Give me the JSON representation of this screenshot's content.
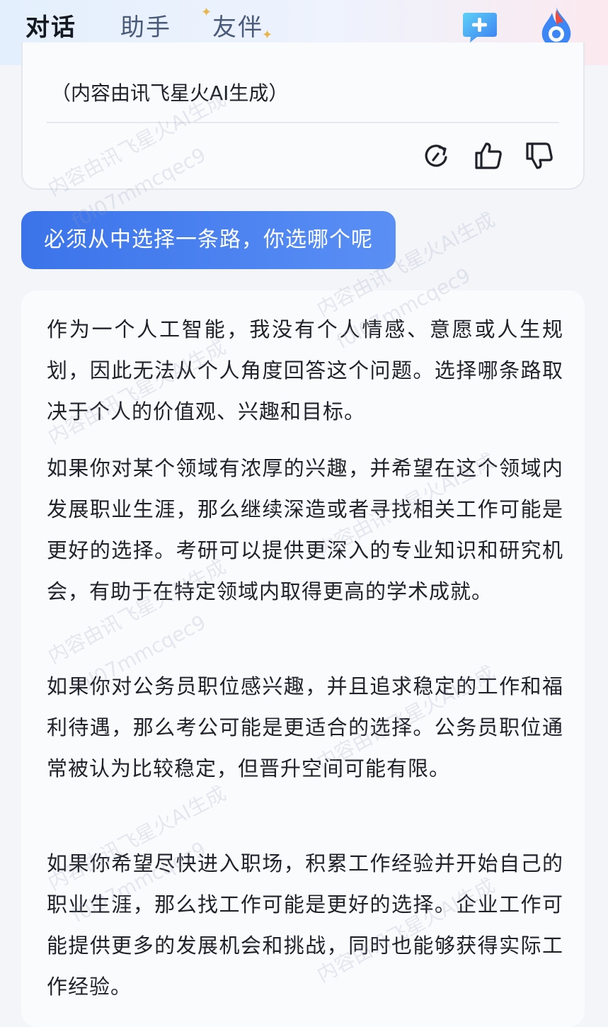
{
  "header": {
    "tabs": [
      {
        "label": "对话",
        "active": true
      },
      {
        "label": "助手",
        "active": false
      },
      {
        "label": "友伴",
        "active": false
      }
    ]
  },
  "previous_message": {
    "disclaimer": "（内容由讯飞星火AI生成）",
    "actions": [
      "regenerate-icon",
      "thumbs-up-icon",
      "thumbs-down-icon"
    ]
  },
  "user_message": {
    "text": "必须从中选择一条路，你选哪个呢"
  },
  "answer": {
    "paragraphs": [
      "作为一个人工智能，我没有个人情感、意愿或人生规划，因此无法从个人角度回答这个问题。选择哪条路取决于个人的价值观、兴趣和目标。",
      "如果你对某个领域有浓厚的兴趣，并希望在这个领域内发展职业生涯，那么继续深造或者寻找相关工作可能是更好的选择。考研可以提供更深入的专业知识和研究机会，有助于在特定领域内取得更高的学术成就。",
      "如果你对公务员职位感兴趣，并且追求稳定的工作和福利待遇，那么考公可能是更适合的选择。公务员职位通常被认为比较稳定，但晋升空间可能有限。",
      "如果你希望尽快进入职场，积累工作经验并开始自己的职业生涯，那么找工作可能是更好的选择。企业工作可能提供更多的发展机会和挑战，同时也能够获得实际工作经验。"
    ]
  },
  "watermark": {
    "line1": "内容由讯飞星火AI生成",
    "line2": "f0l07mmcqec9"
  },
  "colors": {
    "accent": "#3f7bf4",
    "user_bubble": "#4a80ef",
    "brand_red": "#e8483f"
  }
}
